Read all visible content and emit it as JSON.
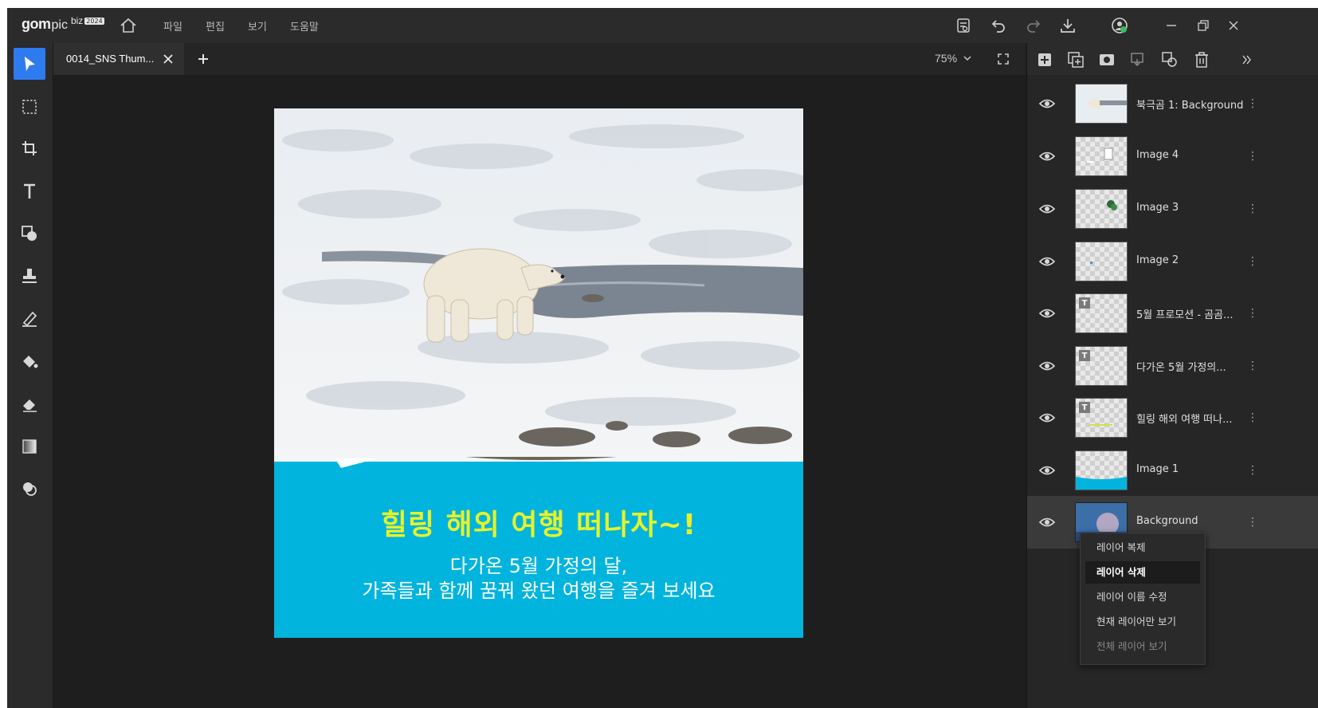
{
  "app": {
    "logo_brand": "gom",
    "logo_sub": "pic",
    "logo_sup": "biz",
    "logo_badge": "2024"
  },
  "menu": [
    "파일",
    "편집",
    "보기",
    "도움말"
  ],
  "top_right_icons": [
    "save-icon",
    "undo-icon",
    "redo-icon",
    "download-icon",
    "account-icon",
    "minimize-icon",
    "restore-icon",
    "close-icon"
  ],
  "tab": {
    "title": "0014_SNS Thum...",
    "add_label": "+"
  },
  "zoom": {
    "value": "75%"
  },
  "tools": [
    "select-tool",
    "marquee-tool",
    "crop-tool",
    "text-tool",
    "shape-tool",
    "stamp-tool",
    "brush-tool",
    "fill-tool",
    "eraser-tool",
    "gradient-tool",
    "blend-tool"
  ],
  "artboard": {
    "headline": "힐링 해외 여행 떠나자~!",
    "subline1": "다가온 5월 가정의 달,",
    "subline2": "가족들과 함께 꿈꿔 왔던 여행을 즐겨 보세요"
  },
  "colors": {
    "accent": "#2e7bf0",
    "banner": "#00b4dd",
    "headline": "#e6f22b"
  },
  "layers": [
    {
      "name": "북극곰 1: Background",
      "kind": "photo"
    },
    {
      "name": "Image 4",
      "kind": "image"
    },
    {
      "name": "Image 3",
      "kind": "image"
    },
    {
      "name": "Image 2",
      "kind": "image"
    },
    {
      "name": "5월 프로모션 - 곰곰...",
      "kind": "text"
    },
    {
      "name": "다가온 5월 가정의...",
      "kind": "text"
    },
    {
      "name": "힐링 해외 여행 떠나...",
      "kind": "text"
    },
    {
      "name": "Image 1",
      "kind": "image"
    },
    {
      "name": "Background",
      "kind": "photo",
      "selected": true
    }
  ],
  "context_menu": [
    {
      "label": "레이어 복제"
    },
    {
      "label": "레이어 삭제",
      "state": "hover"
    },
    {
      "label": "레이어 이름 수정"
    },
    {
      "label": "현재 레이어만 보기"
    },
    {
      "label": "전체 레이어 보기",
      "state": "disabled"
    }
  ]
}
